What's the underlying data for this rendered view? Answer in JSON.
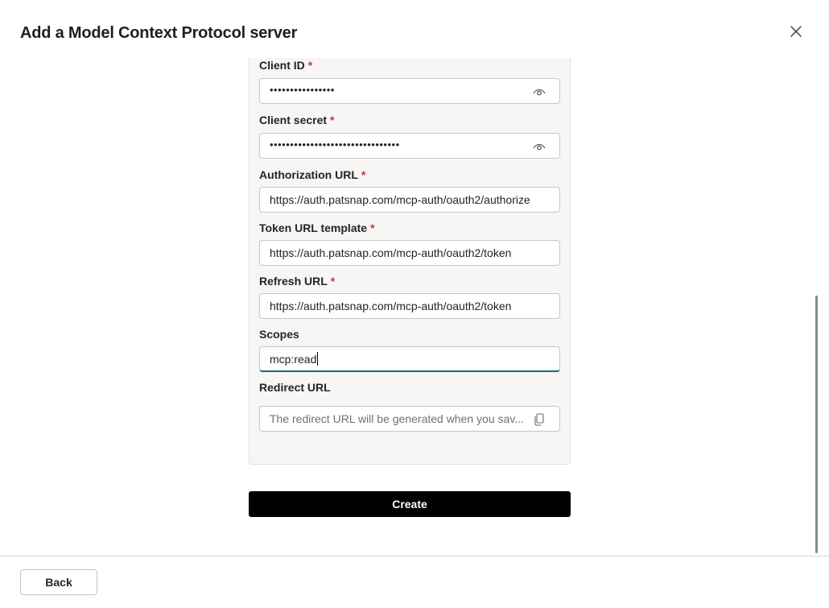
{
  "dialog": {
    "title": "Add a Model Context Protocol server",
    "close_icon": "close-icon"
  },
  "form": {
    "required_marker": "*",
    "client_id": {
      "label": "Client ID",
      "value": "••••••••••••••••",
      "icon": "eye-icon"
    },
    "client_secret": {
      "label": "Client secret",
      "value": "••••••••••••••••••••••••••••••••",
      "icon": "eye-icon"
    },
    "authorization_url": {
      "label": "Authorization URL",
      "value": "https://auth.patsnap.com/mcp-auth/oauth2/authorize"
    },
    "token_url_template": {
      "label": "Token URL template",
      "value": "https://auth.patsnap.com/mcp-auth/oauth2/token"
    },
    "refresh_url": {
      "label": "Refresh URL",
      "value": "https://auth.patsnap.com/mcp-auth/oauth2/token"
    },
    "scopes": {
      "label": "Scopes",
      "value": "mcp:read"
    },
    "redirect_url": {
      "label": "Redirect URL",
      "placeholder": "The redirect URL will be generated when you sav...",
      "icon": "copy-icon"
    }
  },
  "actions": {
    "create_label": "Create",
    "back_label": "Back"
  },
  "colors": {
    "accent": "#0f6e73",
    "required": "#c4314b",
    "primary_button": "#000000",
    "panel_bg": "#f7f6f5"
  }
}
